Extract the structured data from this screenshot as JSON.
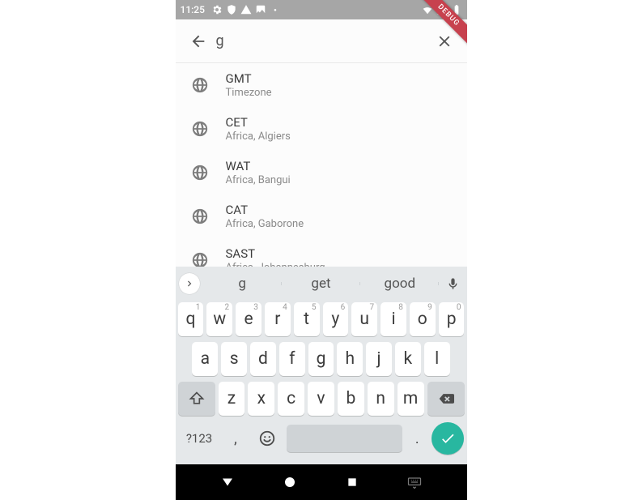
{
  "statusbar": {
    "time": "11:25"
  },
  "debug_label": "DEBUG",
  "search": {
    "value": "g"
  },
  "results": [
    {
      "title": "GMT",
      "sub": "Timezone"
    },
    {
      "title": "CET",
      "sub": "Africa, Algiers"
    },
    {
      "title": "WAT",
      "sub": "Africa, Bangui"
    },
    {
      "title": "CAT",
      "sub": "Africa, Gaborone"
    },
    {
      "title": "SAST",
      "sub": "Africa, Johannesburg"
    }
  ],
  "keyboard": {
    "suggestions": [
      "g",
      "get",
      "good"
    ],
    "row1": [
      {
        "k": "q",
        "n": "1"
      },
      {
        "k": "w",
        "n": "2"
      },
      {
        "k": "e",
        "n": "3"
      },
      {
        "k": "r",
        "n": "4"
      },
      {
        "k": "t",
        "n": "5"
      },
      {
        "k": "y",
        "n": "6"
      },
      {
        "k": "u",
        "n": "7"
      },
      {
        "k": "i",
        "n": "8"
      },
      {
        "k": "o",
        "n": "9"
      },
      {
        "k": "p",
        "n": "0"
      }
    ],
    "row2": [
      "a",
      "s",
      "d",
      "f",
      "g",
      "h",
      "j",
      "k",
      "l"
    ],
    "row3": [
      "z",
      "x",
      "c",
      "v",
      "b",
      "n",
      "m"
    ],
    "symbols_label": "?123",
    "comma": ",",
    "period": "."
  }
}
